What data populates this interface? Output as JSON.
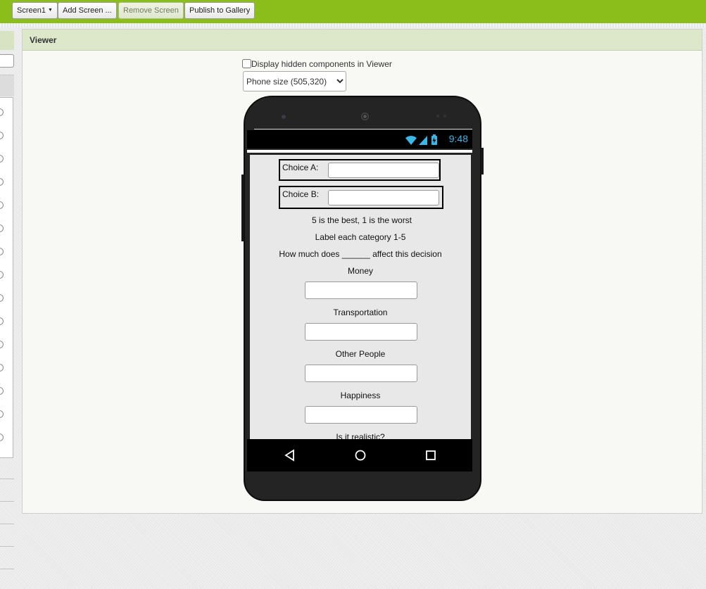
{
  "toolbar": {
    "screen_dropdown": "Screen1",
    "add_screen": "Add Screen ...",
    "remove_screen": "Remove Screen",
    "publish": "Publish to Gallery"
  },
  "viewer": {
    "title": "Viewer",
    "hidden_components_label": "Display hidden components in Viewer",
    "hidden_components_checked": false,
    "size_option": "Phone size (505,320)"
  },
  "phone": {
    "time": "9:48",
    "choice_a_label": "Choice A:",
    "choice_b_label": "Choice B:",
    "rating_hint": "5 is the best, 1 is the worst",
    "instructions": "Label each category 1-5",
    "question": "How much does ______ affect this decision",
    "categories": [
      "Money",
      "Transportation",
      "Other People",
      "Happiness",
      "Is it realistic?"
    ]
  }
}
